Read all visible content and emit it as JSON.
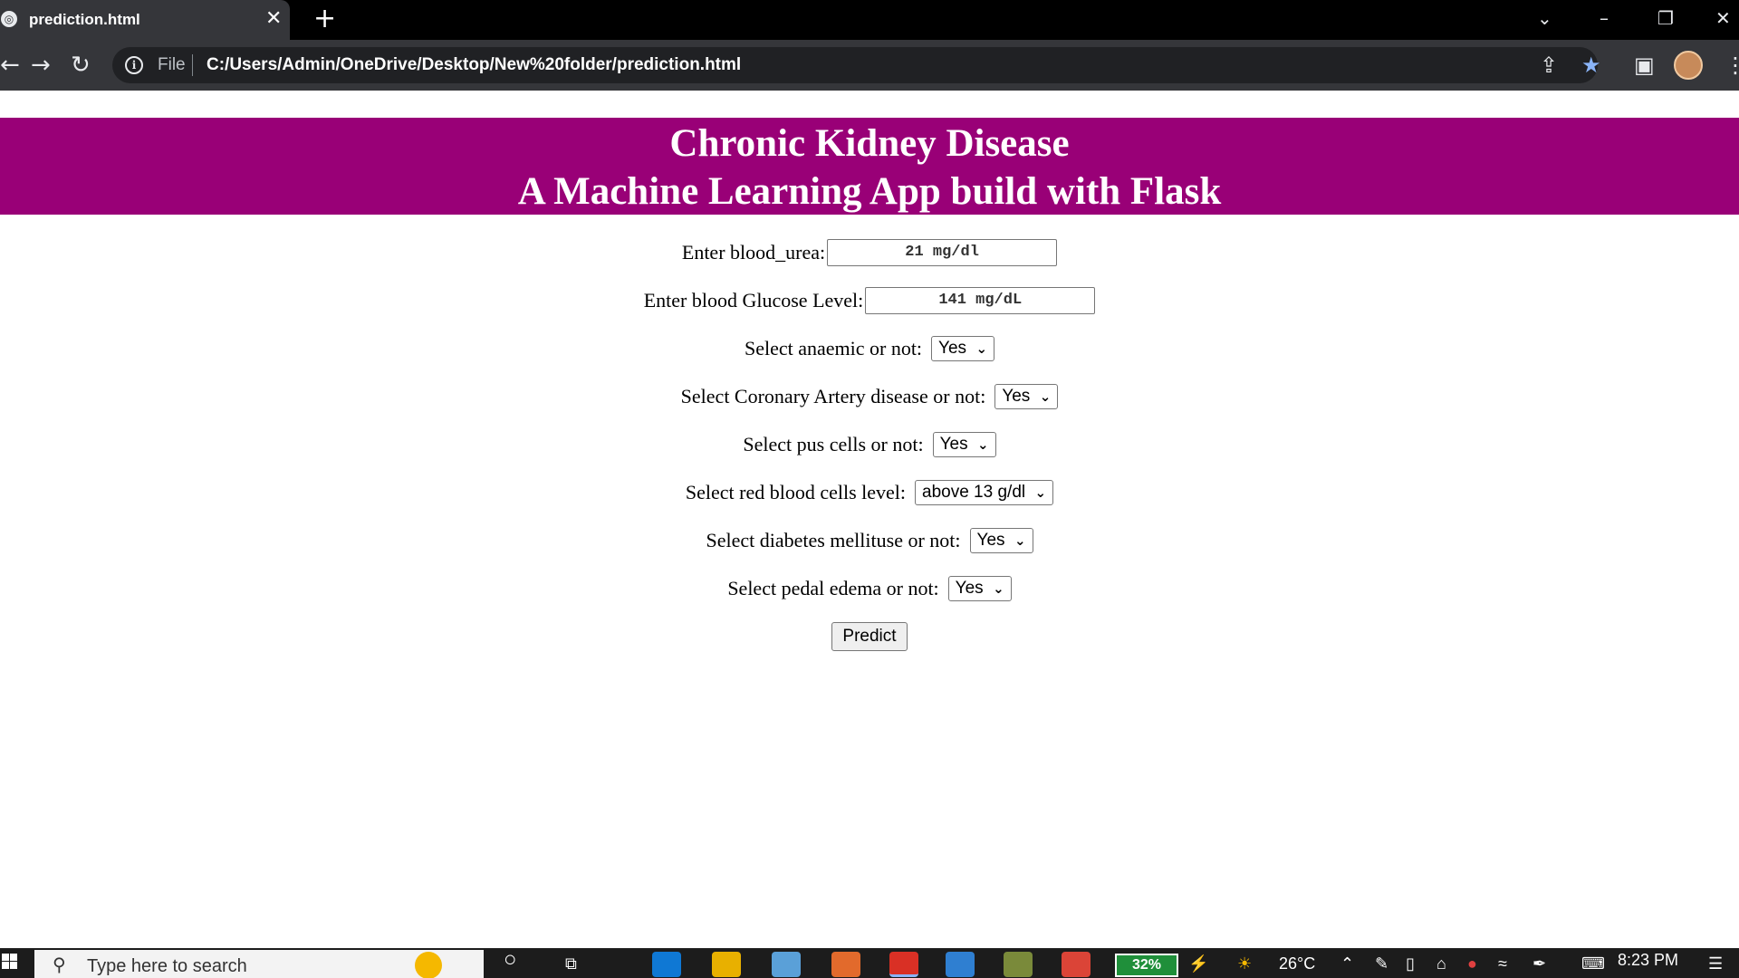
{
  "browser": {
    "tab_title": "prediction.html",
    "url_scheme": "File",
    "url": "C:/Users/Admin/OneDrive/Desktop/New%20folder/prediction.html"
  },
  "banner": {
    "title_line1": "Chronic Kidney Disease",
    "title_line2": "A Machine Learning App build with Flask"
  },
  "form": {
    "blood_urea_label": "Enter blood_urea:",
    "blood_urea_value": "21 mg/dl",
    "glucose_label": "Enter blood Glucose Level:",
    "glucose_value": "141 mg/dL",
    "anaemic_label": "Select anaemic or not:",
    "anaemic_value": "Yes",
    "cad_label": "Select Coronary Artery disease or not:",
    "cad_value": "Yes",
    "pus_label": "Select pus cells or not:",
    "pus_value": "Yes",
    "rbc_label": "Select red blood cells level:",
    "rbc_value": "above 13 g/dl",
    "diabetes_label": "Select diabetes mellituse or not:",
    "diabetes_value": "Yes",
    "pedal_label": "Select pedal edema or not:",
    "pedal_value": "Yes",
    "predict_label": "Predict"
  },
  "taskbar": {
    "search_placeholder": "Type here to search",
    "battery": "32%",
    "temperature": "26°C",
    "time": "8:23 PM"
  },
  "colors": {
    "banner_bg": "#990077",
    "browser_bg": "#35363a"
  }
}
